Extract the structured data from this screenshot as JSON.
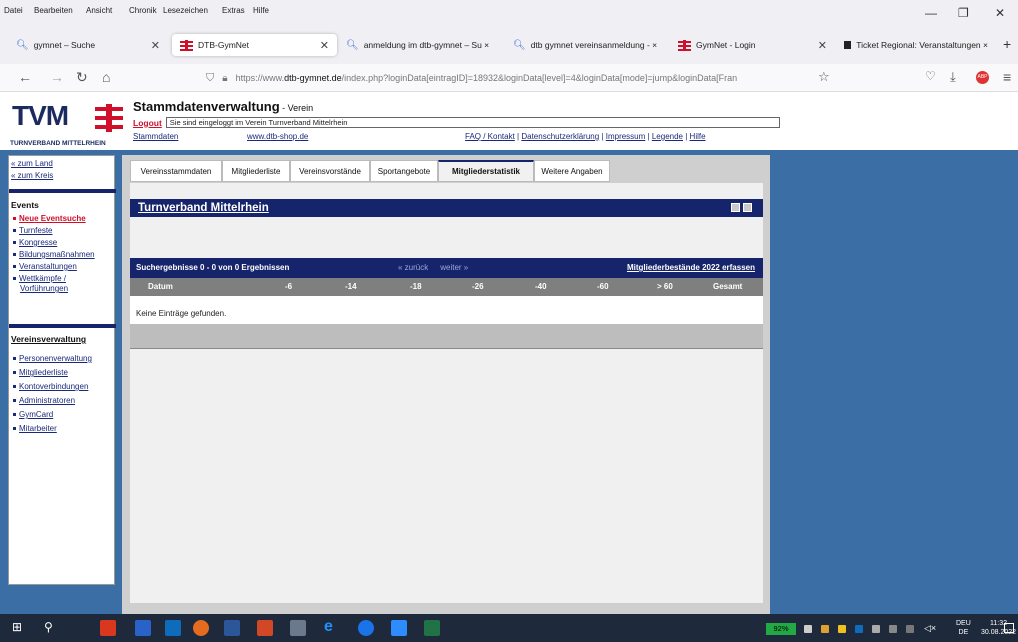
{
  "browser": {
    "menu": [
      "Datei",
      "Bearbeiten",
      "Ansicht",
      "Chronik",
      "Lesezeichen",
      "Extras",
      "Hilfe"
    ],
    "tabs": [
      {
        "label": "gymnet – Suche"
      },
      {
        "label": "DTB-GymNet"
      },
      {
        "label": "anmeldung im dtb-gymnet – Su ×"
      },
      {
        "label": "dtb gymnet vereinsanmeldung - ×"
      },
      {
        "label": "GymNet - Login"
      },
      {
        "label": "Ticket Regional: Veranstaltungen ×"
      }
    ],
    "url_prefix": "https://www.",
    "url_host": "dtb-gymnet.de",
    "url_path": "/index.php?loginData[eintragID]=18932&loginData[level]=4&loginData[mode]=jump&loginData[Fran"
  },
  "header": {
    "logo_text": "TVM",
    "logo_sub": "TURNVERBAND MITTELRHEIN",
    "title": "Stammdatenverwaltung",
    "title_suffix": " - Verein",
    "logout": "Logout",
    "login_info": "Sie sind eingeloggt im Verein Turnverband Mittelrhein",
    "link_stammdaten": "Stammdaten",
    "link_shop": "www.dtb-shop.de",
    "link_faq": "FAQ / Kontakt",
    "link_datenschutz": "Datenschutzerklärung",
    "link_impressum": "Impressum",
    "link_legende": "Legende",
    "link_hilfe": "Hilfe",
    "sep": "|"
  },
  "sidebar": {
    "zum_land": "« zum Land",
    "zum_kreis": "« zum Kreis",
    "events_title": "Events",
    "events": [
      "Neue Eventsuche",
      "Turnfeste",
      "Kongresse",
      "Bildungsmaßnahmen",
      "Veranstaltungen",
      "Wettkämpfe /",
      "Vorführungen"
    ],
    "verein_title": "Vereinsverwaltung",
    "verein": [
      "Personenverwaltung",
      "Mitgliederliste",
      "Kontoverbindungen",
      "Administratoren",
      "GymCard",
      "Mitarbeiter"
    ]
  },
  "content": {
    "tabs": [
      "Vereinsstammdaten",
      "Mitgliederliste",
      "Vereinsvorstände",
      "Sportangebote",
      "Mitgliederstatistik",
      "Weitere Angaben"
    ],
    "club_title": "Turnverband Mittelrhein",
    "results_label": "Suchergebnisse 0 - 0 von 0 Ergebnissen",
    "back": "« zurück",
    "forward": "weiter »",
    "record_link": "Mitgliederbestände 2022 erfassen",
    "columns": [
      "Datum",
      "-6",
      "-14",
      "-18",
      "-26",
      "-40",
      "-60",
      "> 60",
      "Gesamt"
    ],
    "empty": "Keine Einträge gefunden."
  },
  "taskbar": {
    "battery": "92%",
    "lang1": "DEU",
    "lang2": "DE",
    "time": "11:32",
    "date": "30.08.2022"
  },
  "colors": {
    "navy": "#15246b",
    "page_blue": "#3c6ea6",
    "tvm_red": "#d0102a"
  }
}
